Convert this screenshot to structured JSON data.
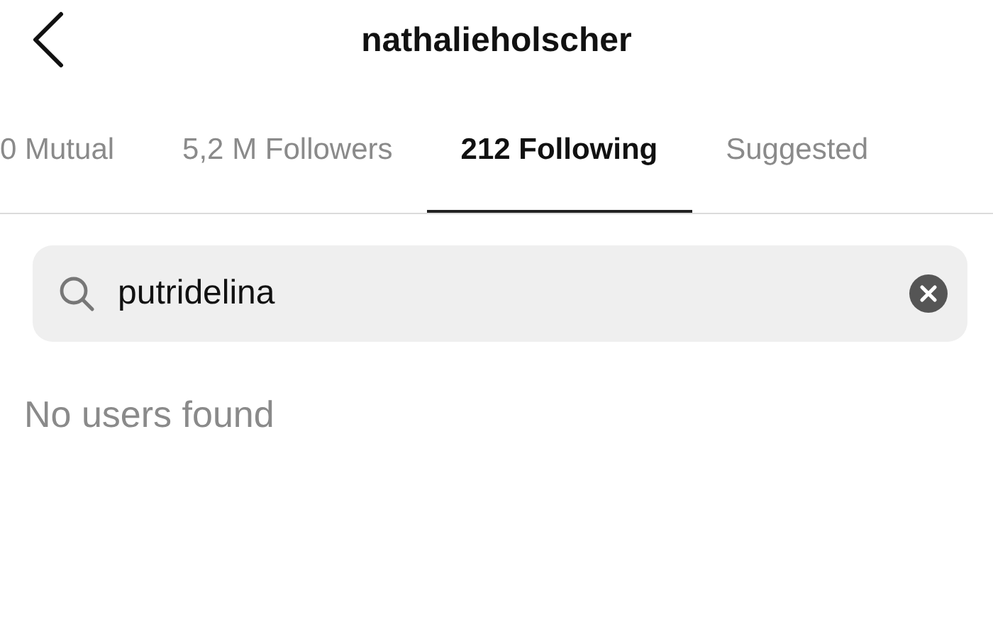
{
  "header": {
    "title": "nathalieholscher"
  },
  "tabs": [
    {
      "label": "0 Mutual",
      "selected": false
    },
    {
      "label": "5,2 M Followers",
      "selected": false
    },
    {
      "label": "212 Following",
      "selected": true
    },
    {
      "label": "Suggested",
      "selected": false
    }
  ],
  "search": {
    "value": "putridelina"
  },
  "empty_message": "No users found"
}
